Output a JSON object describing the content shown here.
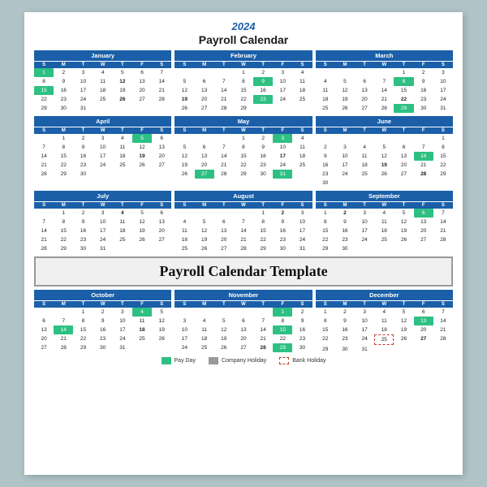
{
  "title": {
    "year": "2024",
    "subtitle": "Payroll Calendar"
  },
  "banner": "Payroll Calendar Template",
  "legend": {
    "pay_day": "Pay Day",
    "company_holiday": "Company Holiday",
    "bank_holiday": "Bank Holiday"
  },
  "months": [
    {
      "name": "January",
      "startDay": 1,
      "days": 31,
      "special": {
        "1": "pay",
        "12": "bold",
        "15": "pay",
        "26": "bold"
      }
    },
    {
      "name": "February",
      "startDay": 4,
      "days": 29,
      "special": {
        "9": "pay",
        "19": "bold",
        "23": "pay"
      }
    },
    {
      "name": "March",
      "startDay": 5,
      "days": 31,
      "special": {
        "8": "pay",
        "22": "bold",
        "29": "pay"
      }
    },
    {
      "name": "April",
      "startDay": 2,
      "days": 30,
      "special": {
        "5": "pay",
        "19": "bold"
      }
    },
    {
      "name": "May",
      "startDay": 4,
      "days": 31,
      "special": {
        "3": "pay",
        "17": "bold",
        "27": "pay",
        "31": "pay"
      }
    },
    {
      "name": "June",
      "startDay": 7,
      "days": 30,
      "special": {
        "14": "pay",
        "19": "bold",
        "28": "bold"
      }
    },
    {
      "name": "July",
      "startDay": 2,
      "days": 31,
      "special": {
        "4": "bold"
      }
    },
    {
      "name": "August",
      "startDay": 5,
      "days": 31,
      "special": {
        "2": "bold"
      }
    },
    {
      "name": "September",
      "startDay": 1,
      "days": 30,
      "special": {
        "2": "bold",
        "6": "pay"
      }
    },
    {
      "name": "October",
      "startDay": 3,
      "days": 31,
      "special": {
        "4": "pay",
        "14": "pay",
        "18": "bold"
      }
    },
    {
      "name": "November",
      "startDay": 6,
      "days": 30,
      "special": {
        "1": "pay",
        "15": "pay",
        "28": "bold",
        "29": "pay"
      }
    },
    {
      "name": "December",
      "startDay": 1,
      "days": 31,
      "special": {
        "13": "pay",
        "25": "bank",
        "27": "bold"
      }
    }
  ],
  "dow": [
    "S",
    "M",
    "T",
    "W",
    "T",
    "F",
    "S"
  ]
}
